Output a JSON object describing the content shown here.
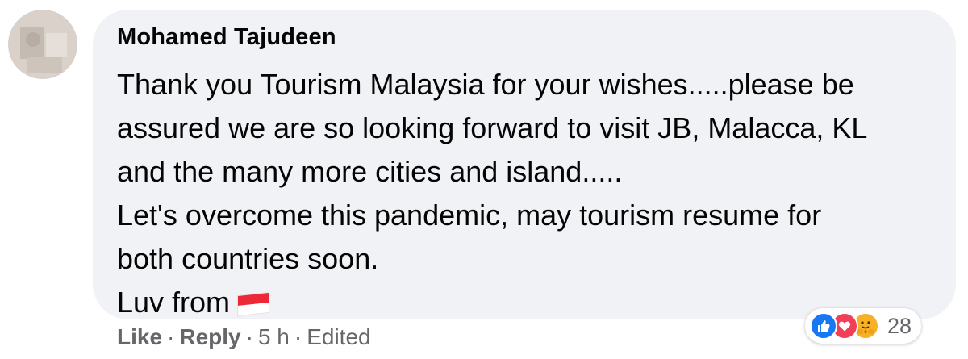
{
  "comment": {
    "author": "Mohamed Tajudeen",
    "lines": [
      "Thank you Tourism Malaysia for your wishes.....please be",
      "assured we are so looking forward to visit JB, Malacca, KL",
      "and the many more cities and island.....",
      "Let's overcome this pandemic, may tourism resume for",
      "both countries soon.",
      "Luv from"
    ],
    "flag_icon": "singapore-flag-icon"
  },
  "reactions": {
    "icons": [
      "like-icon",
      "love-icon",
      "care-icon"
    ],
    "count": "28"
  },
  "actions": {
    "like_label": "Like",
    "reply_label": "Reply",
    "separator": "·",
    "time": "5 h",
    "edited": "Edited"
  },
  "colors": {
    "bubble_bg": "#f0f2f5",
    "text": "#050505",
    "muted": "#65676b",
    "like_blue": "#1877f2",
    "love_red": "#f33e58",
    "care_yellow": "#f7b125"
  }
}
